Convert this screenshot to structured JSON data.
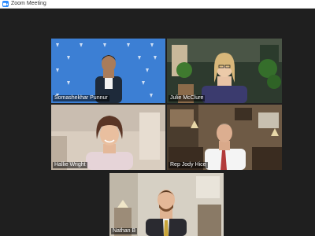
{
  "window": {
    "title": "Zoom Meeting",
    "app_icon": "video-camera-icon"
  },
  "accent": {
    "active_speaker": "#a9e23e",
    "zoom_blue": "#2d8cff"
  },
  "participants": [
    {
      "name": "Somashekhar Punnur",
      "active": false
    },
    {
      "name": "Julie McClure",
      "active": true
    },
    {
      "name": "Hallie Wright",
      "active": false
    },
    {
      "name": "Rep Jody Hice",
      "active": false
    },
    {
      "name": "Nathan B",
      "active": false
    }
  ]
}
